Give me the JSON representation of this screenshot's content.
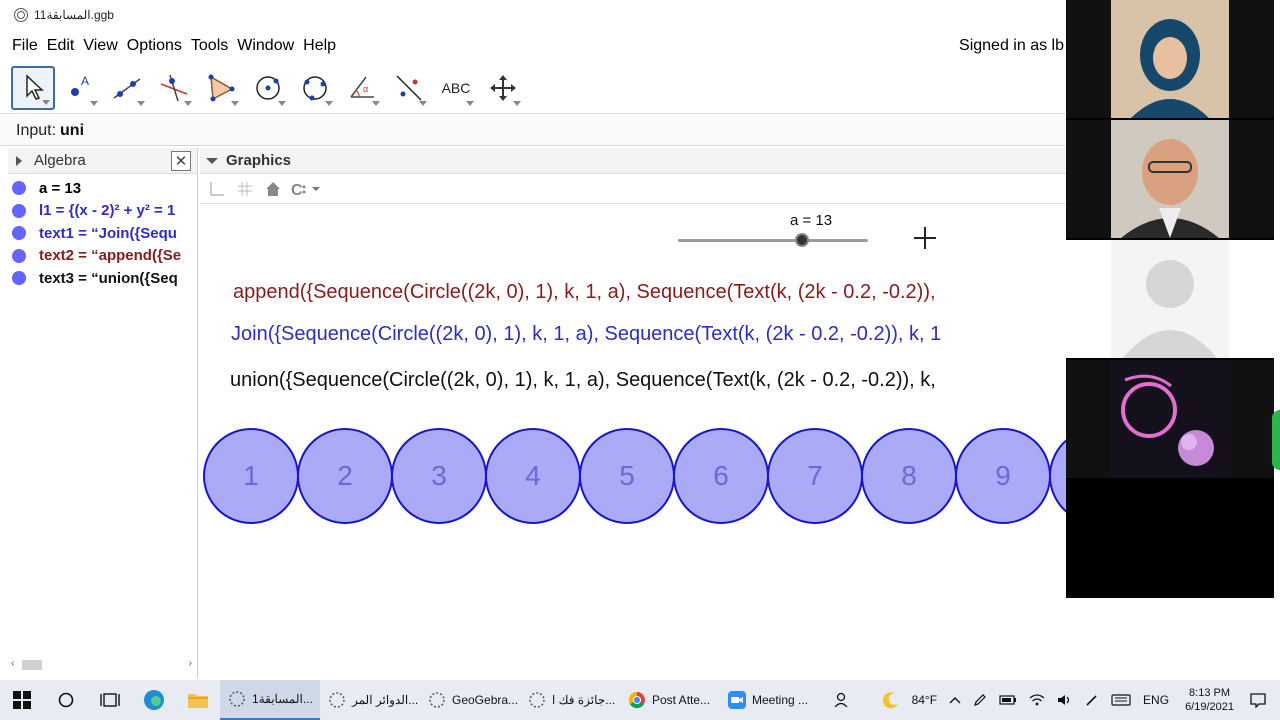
{
  "window": {
    "title": "المسابقة11.ggb"
  },
  "menu": {
    "items": [
      "File",
      "Edit",
      "View",
      "Options",
      "Tools",
      "Window",
      "Help"
    ],
    "signed_in": "Signed in as lb"
  },
  "toolbar": {
    "tools": [
      "move-tool",
      "point-tool",
      "line-tool",
      "perpendicular-line-tool",
      "polygon-tool",
      "circle-center-point-tool",
      "circle-three-points-tool",
      "angle-tool",
      "reflect-tool",
      "text-tool",
      "move-graphics-view-tool"
    ],
    "text_tool_label": "ABC"
  },
  "input_bar": {
    "label": "Input:",
    "value": "uni"
  },
  "algebra": {
    "title": "Algebra",
    "close_label": "✕",
    "items": [
      {
        "text": "a = 13",
        "color": "#000000"
      },
      {
        "text": "l1 = {(x - 2)² + y² = 1",
        "color": "#2d2dc4"
      },
      {
        "text": "text1 = “Join({Sequ",
        "color": "#2d2dc4"
      },
      {
        "text": "text2 = “append({Se",
        "color": "#8a1b1b"
      },
      {
        "text": "text3 = “union({Seq",
        "color": "#111111"
      }
    ],
    "scroll_left": "‹",
    "scroll_right": "›"
  },
  "graphics": {
    "title": "Graphics",
    "slider": {
      "label": "a = 13",
      "value": 13,
      "fraction": 0.65
    },
    "texts": {
      "append": "append({Sequence(Circle((2k, 0), 1), k, 1, a), Sequence(Text(k, (2k - 0.2, -0.2)),",
      "join": "Join({Sequence(Circle((2k, 0), 1), k, 1, a), Sequence(Text(k, (2k - 0.2, -0.2)), k, 1",
      "union": "union({Sequence(Circle((2k, 0), 1), k, 1, a), Sequence(Text(k, (2k - 0.2, -0.2)), k,"
    },
    "circles": [
      "1",
      "2",
      "3",
      "4",
      "5",
      "6",
      "7",
      "8",
      "9",
      ""
    ]
  },
  "taskbar": {
    "tasks": [
      {
        "label": "المسابقة1...",
        "active": true
      },
      {
        "label": "الدوائر المر...",
        "active": false
      },
      {
        "label": "GeoGebra...",
        "active": false
      },
      {
        "label": "جائزة فك ا...",
        "active": false
      },
      {
        "label": "Post Atte...",
        "active": false
      },
      {
        "label": "Meeting ...",
        "active": false
      }
    ],
    "weather": "84°F",
    "language": "ENG",
    "time": "8:13 PM",
    "date": "6/19/2021"
  },
  "colors": {
    "accent": "#3a6ea5",
    "circle_fill": "#aaaaf7",
    "circle_stroke": "#1717c9",
    "algebra_dot": "#6464ff"
  }
}
